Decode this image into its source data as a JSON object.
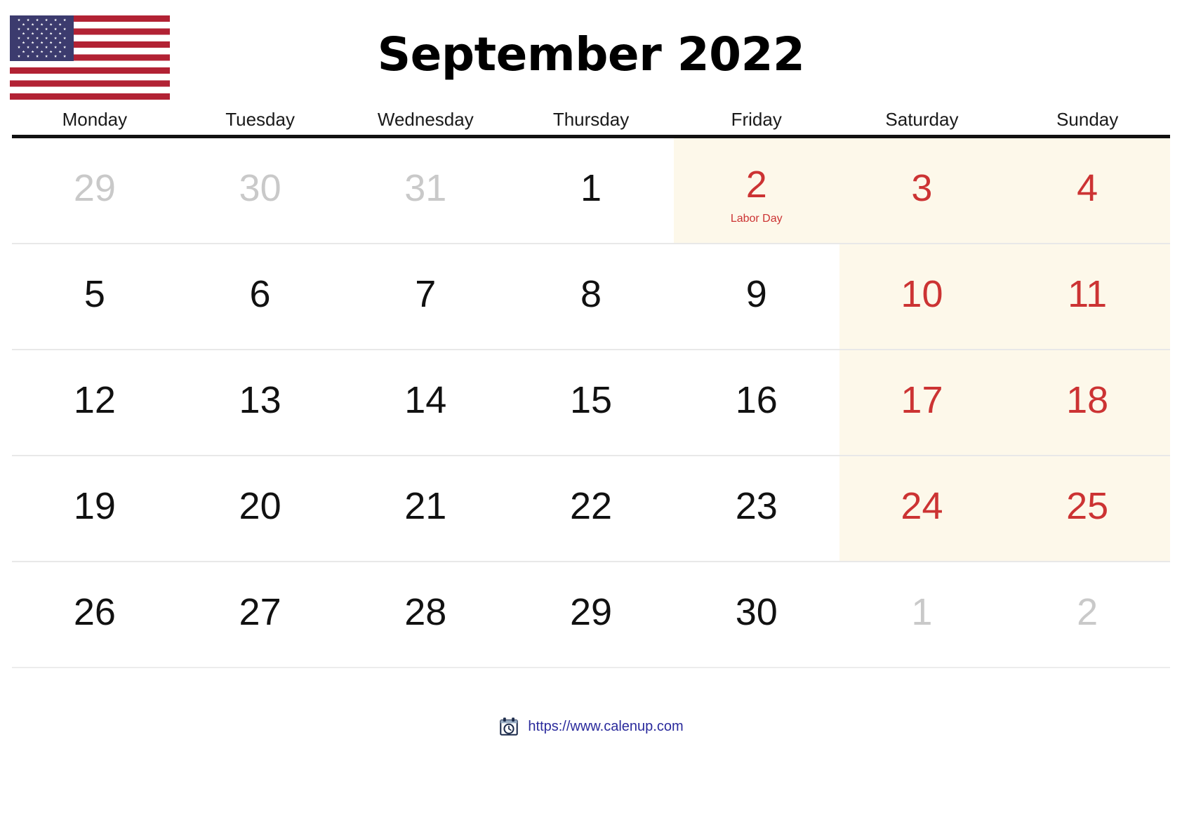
{
  "header": {
    "title": "September 2022",
    "flag_icon": "us-flag-icon",
    "flag_colors": {
      "red": "#B22234",
      "blue": "#3C3B6E",
      "white": "#FFFFFF"
    }
  },
  "colors": {
    "weekend_background": "#FDF8EA",
    "weekend_text": "#CC3333",
    "holiday_text": "#CC3333",
    "out_of_month_text": "#C9C9C9",
    "in_month_text": "#111111",
    "header_rule": "#111111",
    "row_divider": "#E8E8E8",
    "footer_link": "#2A2A9C"
  },
  "weekdays": [
    {
      "label": "Monday"
    },
    {
      "label": "Tuesday"
    },
    {
      "label": "Wednesday"
    },
    {
      "label": "Thursday"
    },
    {
      "label": "Friday"
    },
    {
      "label": "Saturday"
    },
    {
      "label": "Sunday"
    }
  ],
  "weeks": [
    {
      "days": [
        {
          "num": "29",
          "out": true,
          "red": false,
          "shaded": false,
          "holiday": ""
        },
        {
          "num": "30",
          "out": true,
          "red": false,
          "shaded": false,
          "holiday": ""
        },
        {
          "num": "31",
          "out": true,
          "red": false,
          "shaded": false,
          "holiday": ""
        },
        {
          "num": "1",
          "out": false,
          "red": false,
          "shaded": false,
          "holiday": ""
        },
        {
          "num": "2",
          "out": false,
          "red": true,
          "shaded": true,
          "holiday": "Labor Day"
        },
        {
          "num": "3",
          "out": false,
          "red": true,
          "shaded": true,
          "holiday": ""
        },
        {
          "num": "4",
          "out": false,
          "red": true,
          "shaded": true,
          "holiday": ""
        }
      ]
    },
    {
      "days": [
        {
          "num": "5",
          "out": false,
          "red": false,
          "shaded": false,
          "holiday": ""
        },
        {
          "num": "6",
          "out": false,
          "red": false,
          "shaded": false,
          "holiday": ""
        },
        {
          "num": "7",
          "out": false,
          "red": false,
          "shaded": false,
          "holiday": ""
        },
        {
          "num": "8",
          "out": false,
          "red": false,
          "shaded": false,
          "holiday": ""
        },
        {
          "num": "9",
          "out": false,
          "red": false,
          "shaded": false,
          "holiday": ""
        },
        {
          "num": "10",
          "out": false,
          "red": true,
          "shaded": true,
          "holiday": ""
        },
        {
          "num": "11",
          "out": false,
          "red": true,
          "shaded": true,
          "holiday": ""
        }
      ]
    },
    {
      "days": [
        {
          "num": "12",
          "out": false,
          "red": false,
          "shaded": false,
          "holiday": ""
        },
        {
          "num": "13",
          "out": false,
          "red": false,
          "shaded": false,
          "holiday": ""
        },
        {
          "num": "14",
          "out": false,
          "red": false,
          "shaded": false,
          "holiday": ""
        },
        {
          "num": "15",
          "out": false,
          "red": false,
          "shaded": false,
          "holiday": ""
        },
        {
          "num": "16",
          "out": false,
          "red": false,
          "shaded": false,
          "holiday": ""
        },
        {
          "num": "17",
          "out": false,
          "red": true,
          "shaded": true,
          "holiday": ""
        },
        {
          "num": "18",
          "out": false,
          "red": true,
          "shaded": true,
          "holiday": ""
        }
      ]
    },
    {
      "days": [
        {
          "num": "19",
          "out": false,
          "red": false,
          "shaded": false,
          "holiday": ""
        },
        {
          "num": "20",
          "out": false,
          "red": false,
          "shaded": false,
          "holiday": ""
        },
        {
          "num": "21",
          "out": false,
          "red": false,
          "shaded": false,
          "holiday": ""
        },
        {
          "num": "22",
          "out": false,
          "red": false,
          "shaded": false,
          "holiday": ""
        },
        {
          "num": "23",
          "out": false,
          "red": false,
          "shaded": false,
          "holiday": ""
        },
        {
          "num": "24",
          "out": false,
          "red": true,
          "shaded": true,
          "holiday": ""
        },
        {
          "num": "25",
          "out": false,
          "red": true,
          "shaded": true,
          "holiday": ""
        }
      ]
    },
    {
      "days": [
        {
          "num": "26",
          "out": false,
          "red": false,
          "shaded": false,
          "holiday": ""
        },
        {
          "num": "27",
          "out": false,
          "red": false,
          "shaded": false,
          "holiday": ""
        },
        {
          "num": "28",
          "out": false,
          "red": false,
          "shaded": false,
          "holiday": ""
        },
        {
          "num": "29",
          "out": false,
          "red": false,
          "shaded": false,
          "holiday": ""
        },
        {
          "num": "30",
          "out": false,
          "red": false,
          "shaded": false,
          "holiday": ""
        },
        {
          "num": "1",
          "out": true,
          "red": false,
          "shaded": false,
          "holiday": ""
        },
        {
          "num": "2",
          "out": true,
          "red": false,
          "shaded": false,
          "holiday": ""
        }
      ]
    }
  ],
  "footer": {
    "icon": "calendar-clock-icon",
    "url": "https://www.calenup.com"
  }
}
